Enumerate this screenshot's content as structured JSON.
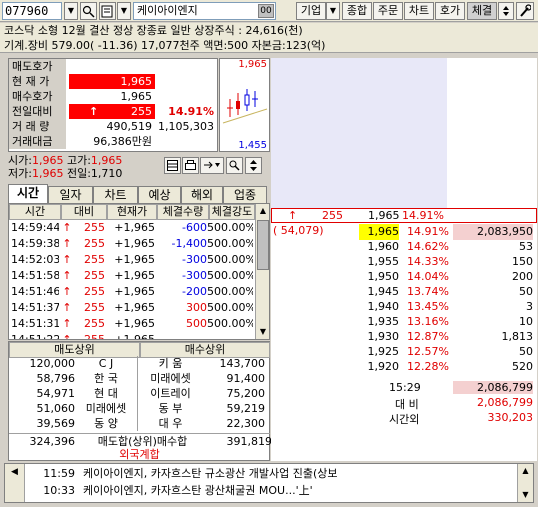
{
  "toolbar": {
    "code": "077960",
    "name": "케이아이엔지",
    "code_hint": "00",
    "buttons": [
      "기업",
      "종합",
      "주문",
      "차트",
      "호가",
      "체결"
    ]
  },
  "info": {
    "line1": "코스닥 소형 12월 결산  정상 장종료 일반 상장주식 : 24,616(천)",
    "line2": "기계.장비   579.00( -11.36) 17,077천주 액면:500 자본금:123(억)"
  },
  "quote": {
    "labels": [
      "매도호가",
      "현 재 가",
      "매수호가",
      "전일대비",
      "거 래 량",
      "거래대금"
    ],
    "current_price": "1,965",
    "bid_price": "1,965",
    "change_arrow": "↑",
    "change": "255",
    "change_pct": "14.91%",
    "volume": "490,519",
    "volume_prev": "1,105,303",
    "amount": "96,386만원",
    "chart_high": "1,965",
    "chart_low": "1,455"
  },
  "ohlc": {
    "open_label": "시가:",
    "open": "1,965",
    "high_label": "고가:",
    "high": "1,965",
    "low_label": "저가:",
    "low": "1,965",
    "prev_label": "전일:",
    "prev": "1,710"
  },
  "tabs": [
    "시간",
    "일자",
    "차트",
    "예상",
    "해외",
    "업종"
  ],
  "ticks": {
    "headers": [
      "시간",
      "대비",
      "현재가",
      "체결수량",
      "체결강도"
    ],
    "rows": [
      {
        "time": "14:59:44",
        "arrow": "↑",
        "diff": "255",
        "price": "+1,965",
        "qty": "-600",
        "str": "500.00%"
      },
      {
        "time": "14:59:38",
        "arrow": "↑",
        "diff": "255",
        "price": "+1,965",
        "qty": "-1,400",
        "str": "500.00%"
      },
      {
        "time": "14:52:03",
        "arrow": "↑",
        "diff": "255",
        "price": "+1,965",
        "qty": "-300",
        "str": "500.00%"
      },
      {
        "time": "14:51:58",
        "arrow": "↑",
        "diff": "255",
        "price": "+1,965",
        "qty": "-300",
        "str": "500.00%"
      },
      {
        "time": "14:51:46",
        "arrow": "↑",
        "diff": "255",
        "price": "+1,965",
        "qty": "-200",
        "str": "500.00%"
      },
      {
        "time": "14:51:37",
        "arrow": "↑",
        "diff": "255",
        "price": "+1,965",
        "qty": "300",
        "str": "500.00%"
      },
      {
        "time": "14:51:31",
        "arrow": "↑",
        "diff": "255",
        "price": "+1,965",
        "qty": "500",
        "str": "500.00%"
      },
      {
        "time": "14:51:22",
        "arrow": "↑",
        "diff": "255",
        "price": "+1,965",
        "qty": "",
        "str": ""
      }
    ]
  },
  "brokers": {
    "sell_header": "매도상위",
    "buy_header": "매수상위",
    "rows": [
      {
        "sqty": "120,000",
        "sname": "C J",
        "bname": "키 움",
        "bqty": "143,700"
      },
      {
        "sqty": "58,796",
        "sname": "한 국",
        "bname": "미래에셋",
        "bqty": "91,400"
      },
      {
        "sqty": "54,971",
        "sname": "현 대",
        "bname": "이트레이",
        "bqty": "75,200"
      },
      {
        "sqty": "51,060",
        "sname": "미래에셋",
        "bname": "동 부",
        "bqty": "59,219"
      },
      {
        "sqty": "39,569",
        "sname": "동 양",
        "bname": "대 우",
        "bqty": "22,300"
      }
    ],
    "total_sell": "324,396",
    "total_label": "매도합(상위)매수합",
    "total_buy": "391,819",
    "foreign_label": "외국계합"
  },
  "orderbook": {
    "summary_arrow": "↑",
    "summary_change": "255",
    "summary_price": "1,965",
    "summary_pct": "14.91%",
    "bid_total": "( 54,079)",
    "bids": [
      {
        "price": "1,965",
        "pct": "14.91%",
        "qty": "2,083,950"
      },
      {
        "price": "1,960",
        "pct": "14.62%",
        "qty": "53"
      },
      {
        "price": "1,955",
        "pct": "14.33%",
        "qty": "150"
      },
      {
        "price": "1,950",
        "pct": "14.04%",
        "qty": "200"
      },
      {
        "price": "1,945",
        "pct": "13.74%",
        "qty": "50"
      },
      {
        "price": "1,940",
        "pct": "13.45%",
        "qty": "3"
      },
      {
        "price": "1,935",
        "pct": "13.16%",
        "qty": "10"
      },
      {
        "price": "1,930",
        "pct": "12.87%",
        "qty": "1,813"
      },
      {
        "price": "1,925",
        "pct": "12.57%",
        "qty": "50"
      },
      {
        "price": "1,920",
        "pct": "12.28%",
        "qty": "520"
      }
    ],
    "time": "15:29",
    "time_qty": "2,086,799",
    "diff_label": "대 비",
    "diff_qty": "2,086,799",
    "after_label": "시간외",
    "after_qty": "330,203"
  },
  "news": [
    {
      "time": "11:59",
      "text": "케이아이엔지, 카자흐스탄 규소광산 개발사업 진출(상보"
    },
    {
      "time": "10:33",
      "text": "케이아이엔지, 카자흐스탄 광산채굴권 MOU...'上'"
    }
  ]
}
